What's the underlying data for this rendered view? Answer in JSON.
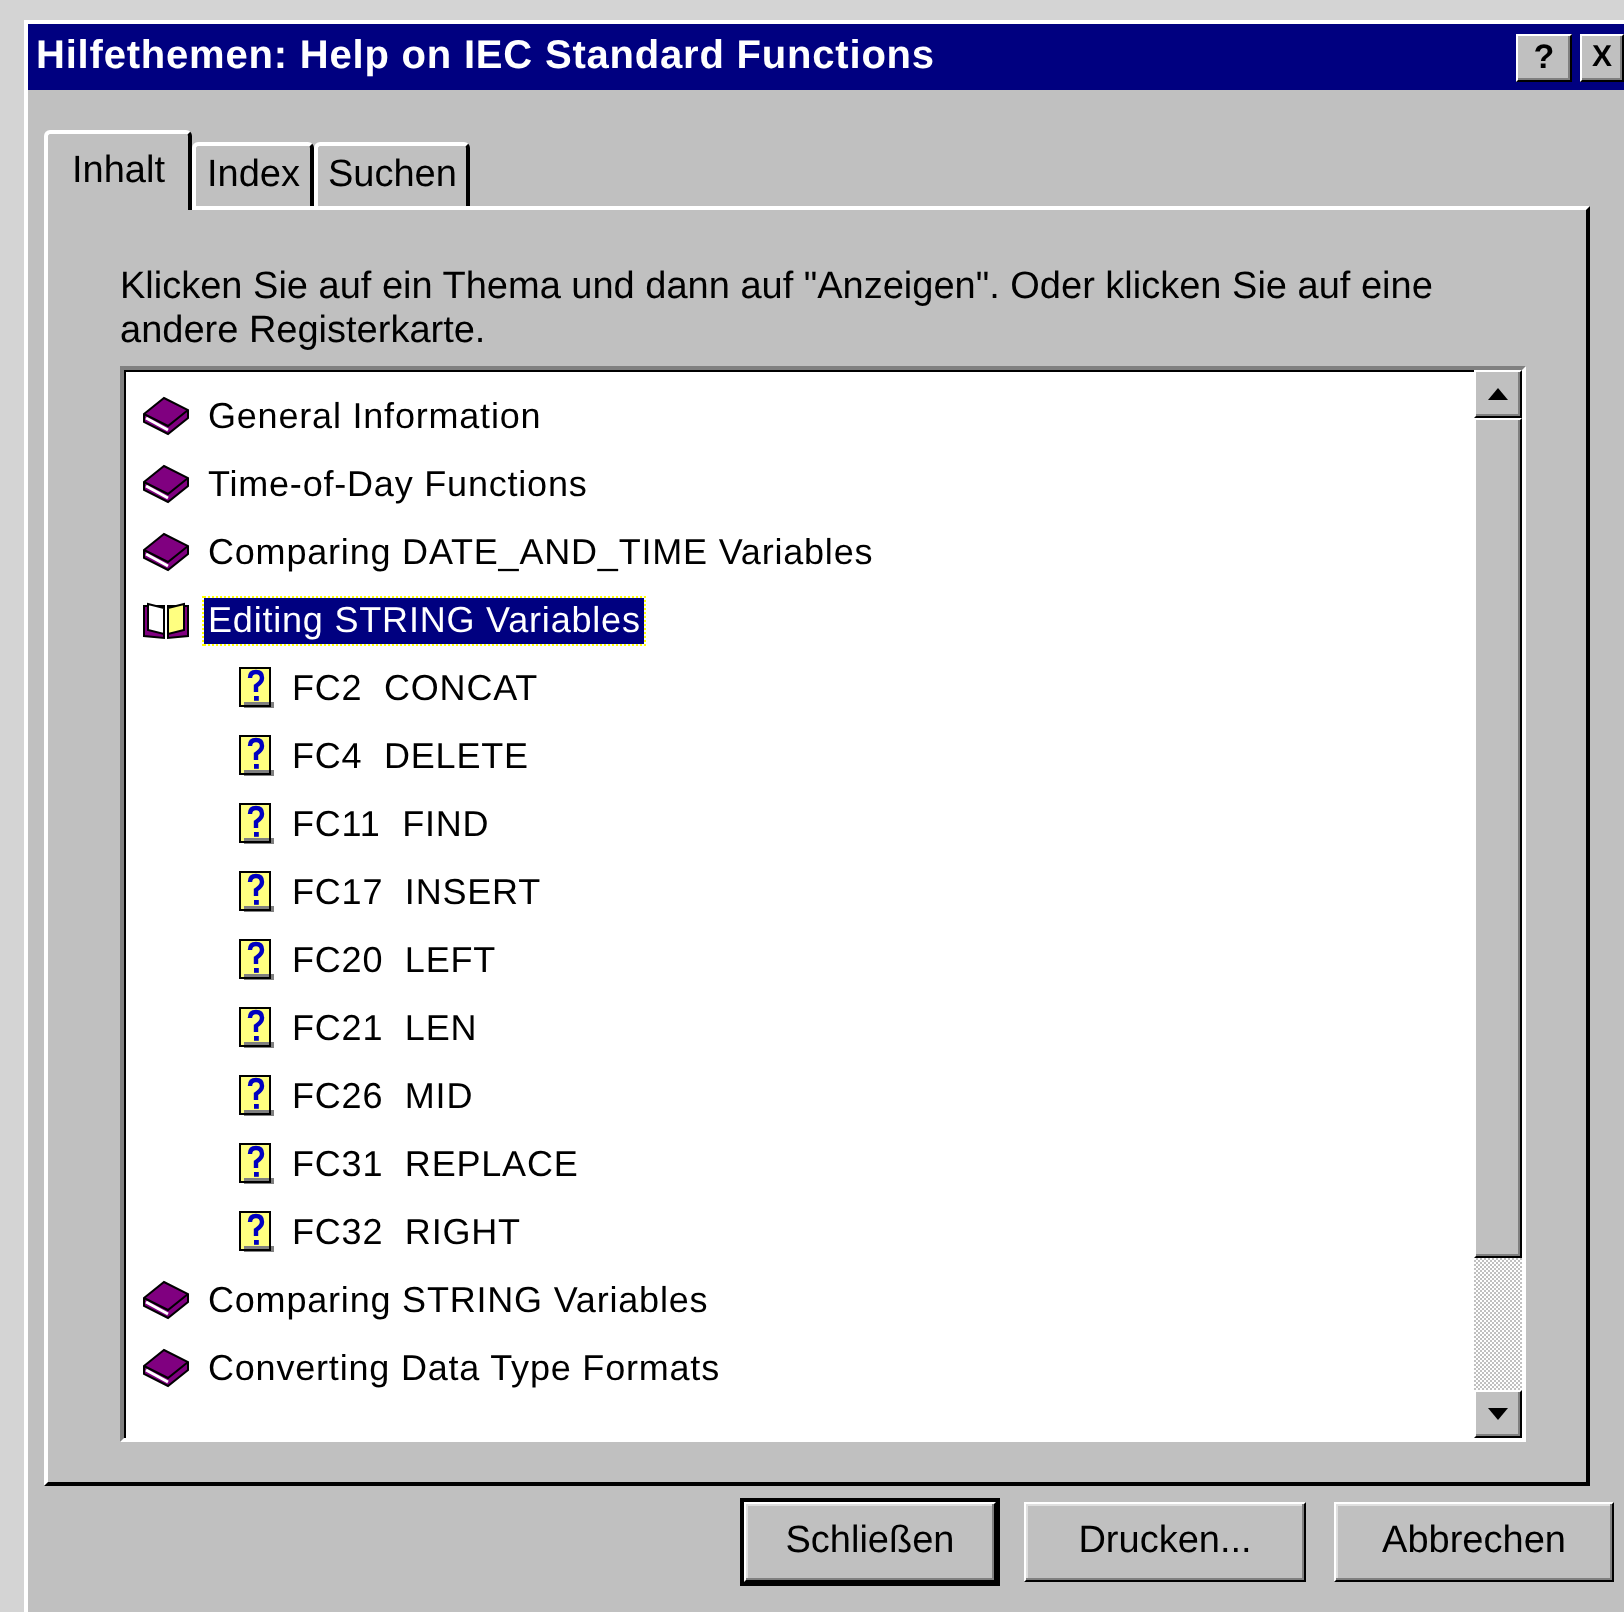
{
  "window": {
    "title": "Hilfethemen: Help on IEC Standard Functions",
    "buttons": [
      {
        "kind": "help",
        "label": "?"
      },
      {
        "kind": "close",
        "label": "X"
      }
    ]
  },
  "tabs": [
    {
      "label": "Inhalt",
      "selected": true
    },
    {
      "label": "Index",
      "selected": false
    },
    {
      "label": "Suchen",
      "selected": false
    }
  ],
  "instruction": "Klicken Sie auf ein Thema und dann auf \"Anzeigen\". Oder klicken Sie auf eine andere Registerkarte.",
  "tree": [
    {
      "kind": "book",
      "label": "General Information",
      "expanded": false,
      "selected": false
    },
    {
      "kind": "book",
      "label": "Time-of-Day Functions",
      "expanded": false,
      "selected": false
    },
    {
      "kind": "book",
      "label": "Comparing DATE_AND_TIME Variables",
      "expanded": false,
      "selected": false
    },
    {
      "kind": "book",
      "label": "Editing STRING Variables",
      "expanded": true,
      "selected": true,
      "children": [
        {
          "kind": "topic",
          "label": "FC2  CONCAT",
          "selected": false
        },
        {
          "kind": "topic",
          "label": "FC4  DELETE",
          "selected": false
        },
        {
          "kind": "topic",
          "label": "FC11  FIND",
          "selected": false
        },
        {
          "kind": "topic",
          "label": "FC17  INSERT",
          "selected": false
        },
        {
          "kind": "topic",
          "label": "FC20  LEFT",
          "selected": false
        },
        {
          "kind": "topic",
          "label": "FC21  LEN",
          "selected": false
        },
        {
          "kind": "topic",
          "label": "FC26  MID",
          "selected": false
        },
        {
          "kind": "topic",
          "label": "FC31  REPLACE",
          "selected": false
        },
        {
          "kind": "topic",
          "label": "FC32  RIGHT",
          "selected": false
        }
      ]
    },
    {
      "kind": "book",
      "label": "Comparing STRING Variables",
      "expanded": false,
      "selected": false
    },
    {
      "kind": "book",
      "label": "Converting Data Type Formats",
      "expanded": false,
      "selected": false
    }
  ],
  "buttons": [
    {
      "label": "Schließen",
      "default": true
    },
    {
      "label": "Drucken...",
      "default": false
    },
    {
      "label": "Abbrechen",
      "default": false
    }
  ]
}
